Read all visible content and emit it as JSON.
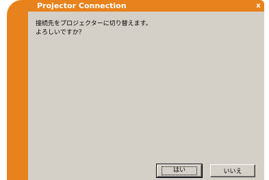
{
  "window": {
    "title": "Projector Connection",
    "close_glyph": "x"
  },
  "message": {
    "line1": "接続先をプロジェクターに切り替えます。",
    "line2": "よろしいですか？"
  },
  "buttons": {
    "yes_label": "はい",
    "no_label": "いいえ"
  },
  "colors": {
    "frame": "#e8821c",
    "content_background": "#d4d0c8"
  }
}
